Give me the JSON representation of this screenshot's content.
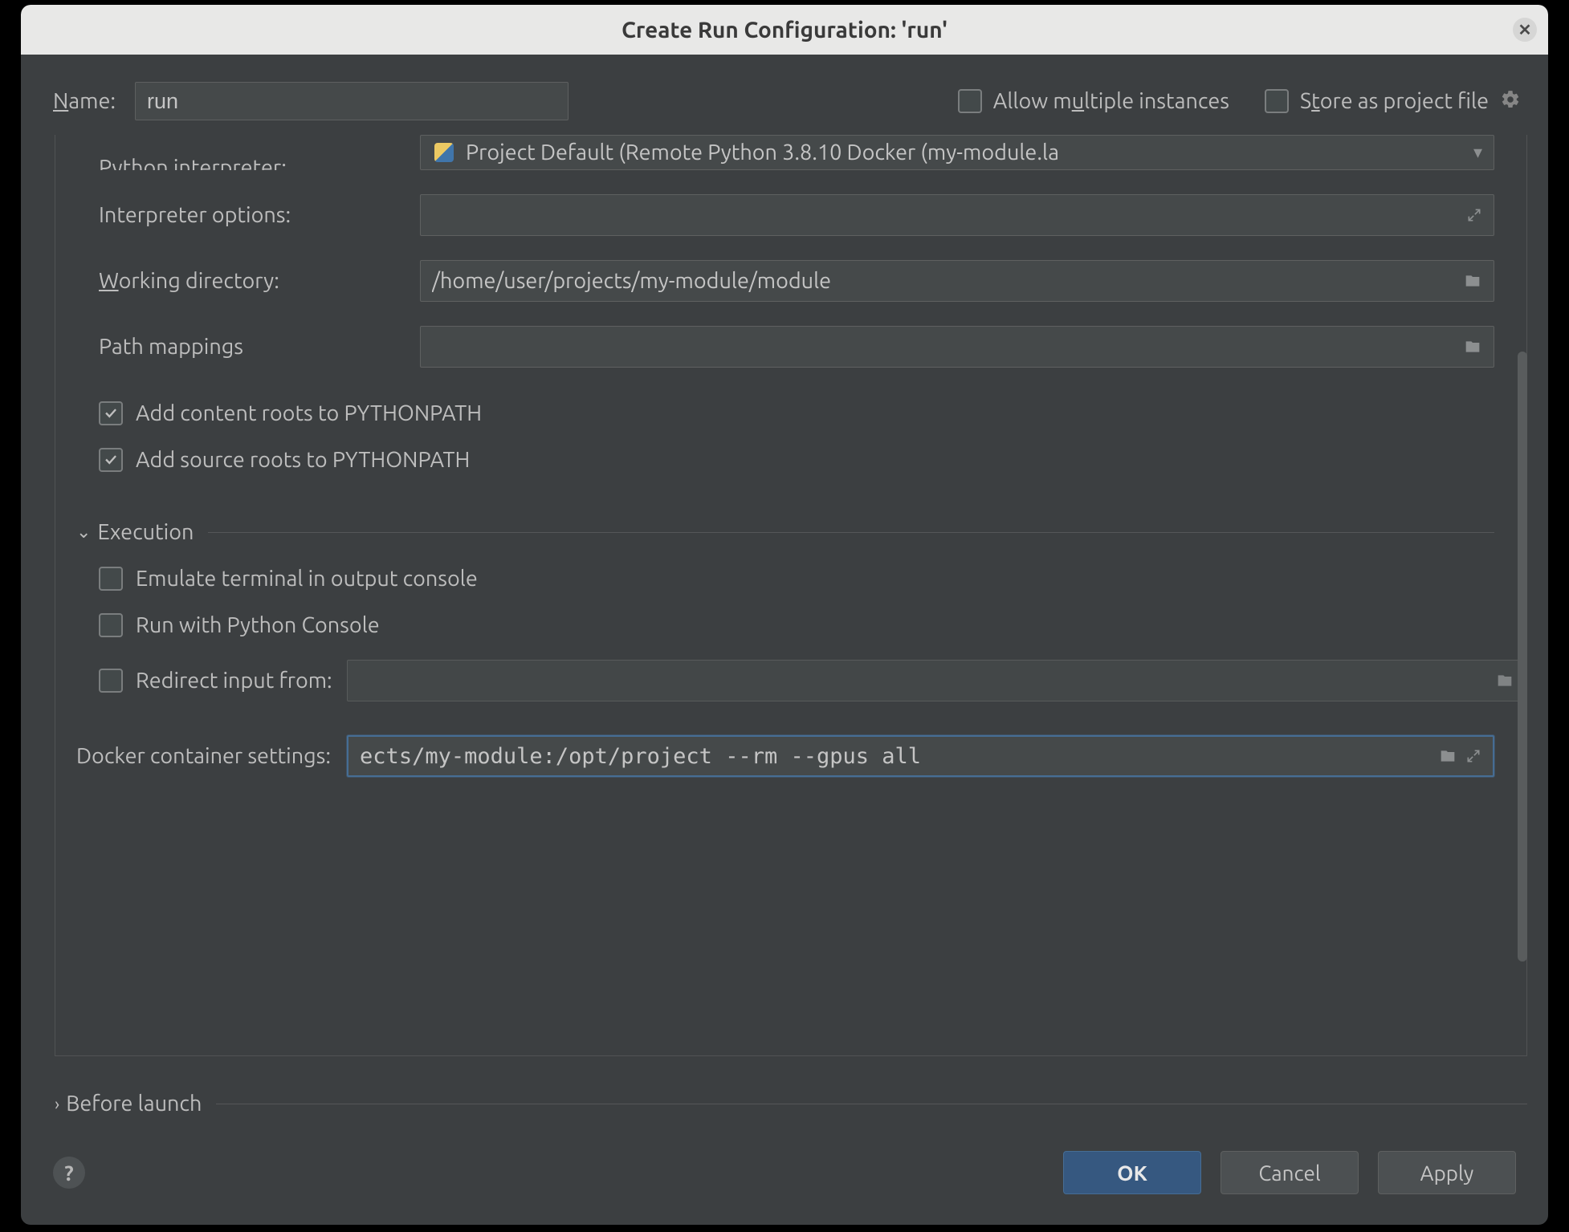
{
  "title": "Create Run Configuration: 'run'",
  "name_row": {
    "label_pre": "N",
    "label_post": "ame:",
    "value": "run",
    "allow_multiple_pre": "Allow m",
    "allow_multiple_mid": "u",
    "allow_multiple_post": "ltiple instances",
    "store_project_pre": "S",
    "store_project_mid": "t",
    "store_project_post": "ore as project file",
    "allow_multiple_checked": false,
    "store_project_checked": false
  },
  "interpreter_row": {
    "label_pre": "P",
    "label_mid": "y",
    "label_post": "thon interpreter:",
    "value": "Project Default (Remote Python 3.8.10 Docker (my-module.la"
  },
  "fields": {
    "interpreter_options_label": "Interpreter options:",
    "interpreter_options_value": "",
    "wd_label_pre": "W",
    "wd_label_post": "orking directory:",
    "wd_value": "/home/user/projects/my-module/module",
    "path_mappings_label": "Path mappings",
    "path_mappings_value": ""
  },
  "pythonpath": {
    "content_roots": "Add content roots to PYTHONPATH",
    "content_roots_checked": true,
    "source_roots": "Add source roots to PYTHONPATH",
    "source_roots_checked": true
  },
  "execution": {
    "header": "Execution",
    "emulate_terminal": "Emulate terminal in output console",
    "emulate_terminal_checked": false,
    "python_console": "Run with Python Console",
    "python_console_checked": false,
    "redirect_label": "Redirect input from:",
    "redirect_checked": false,
    "redirect_value": ""
  },
  "docker": {
    "label": "Docker container settings:",
    "value": "ects/my-module:/opt/project --rm --gpus all"
  },
  "before_launch": {
    "header": "Before launch"
  },
  "buttons": {
    "help": "?",
    "ok": "OK",
    "cancel": "Cancel",
    "apply": "Apply"
  }
}
